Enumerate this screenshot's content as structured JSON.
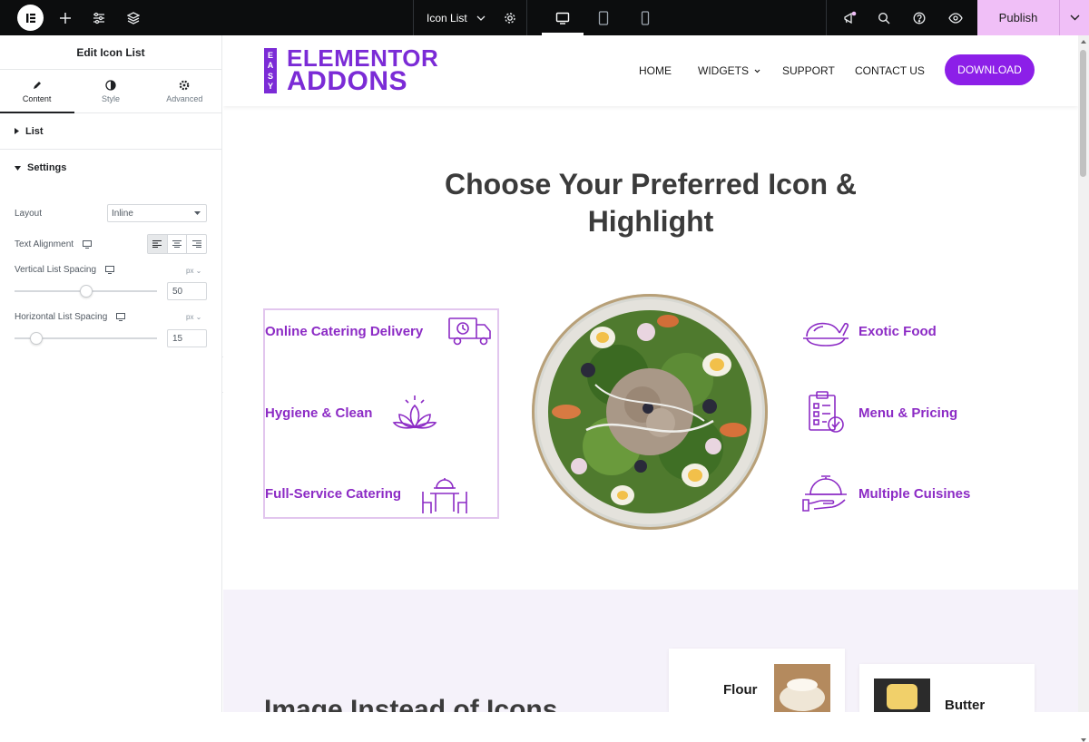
{
  "editor": {
    "document_title": "Icon List",
    "publish_label": "Publish"
  },
  "panel": {
    "title": "Edit Icon List",
    "tabs": [
      {
        "label": "Content",
        "icon": "pencil-icon"
      },
      {
        "label": "Style",
        "icon": "half-circle-icon"
      },
      {
        "label": "Advanced",
        "icon": "gear-icon"
      }
    ],
    "sections": {
      "list_label": "List",
      "settings_label": "Settings"
    },
    "controls": {
      "layout_label": "Layout",
      "layout_value": "Inline",
      "text_alignment_label": "Text Alignment",
      "vertical_spacing_label": "Vertical List Spacing",
      "vertical_spacing_unit": "px",
      "vertical_spacing_value": "50",
      "horizontal_spacing_label": "Horizontal List Spacing",
      "horizontal_spacing_unit": "px",
      "horizontal_spacing_value": "15"
    }
  },
  "site": {
    "brand_easy": [
      "E",
      "A",
      "S",
      "Y"
    ],
    "brand_line1": "ELEMENTOR",
    "brand_line2": "ADDONS",
    "nav": [
      "HOME",
      "WIDGETS",
      "SUPPORT",
      "CONTACT US"
    ],
    "download_label": "DOWNLOAD",
    "accent": "#8c1fe8",
    "hero_title_line1": "Choose Your Preferred Icon &",
    "hero_title_line2": "Highlight",
    "left_list": [
      {
        "text": "Online Catering Delivery",
        "icon": "delivery-truck-icon"
      },
      {
        "text": "Hygiene & Clean",
        "icon": "lotus-icon"
      },
      {
        "text": "Full-Service Catering",
        "icon": "dining-table-icon"
      }
    ],
    "right_list": [
      {
        "text": "Exotic Food",
        "icon": "roast-chicken-icon"
      },
      {
        "text": "Menu & Pricing",
        "icon": "clipboard-check-icon"
      },
      {
        "text": "Multiple Cuisines",
        "icon": "cloche-icon"
      }
    ],
    "section2_title": "Image Instead of Icons",
    "cards": [
      "Flour",
      "Butter"
    ]
  }
}
